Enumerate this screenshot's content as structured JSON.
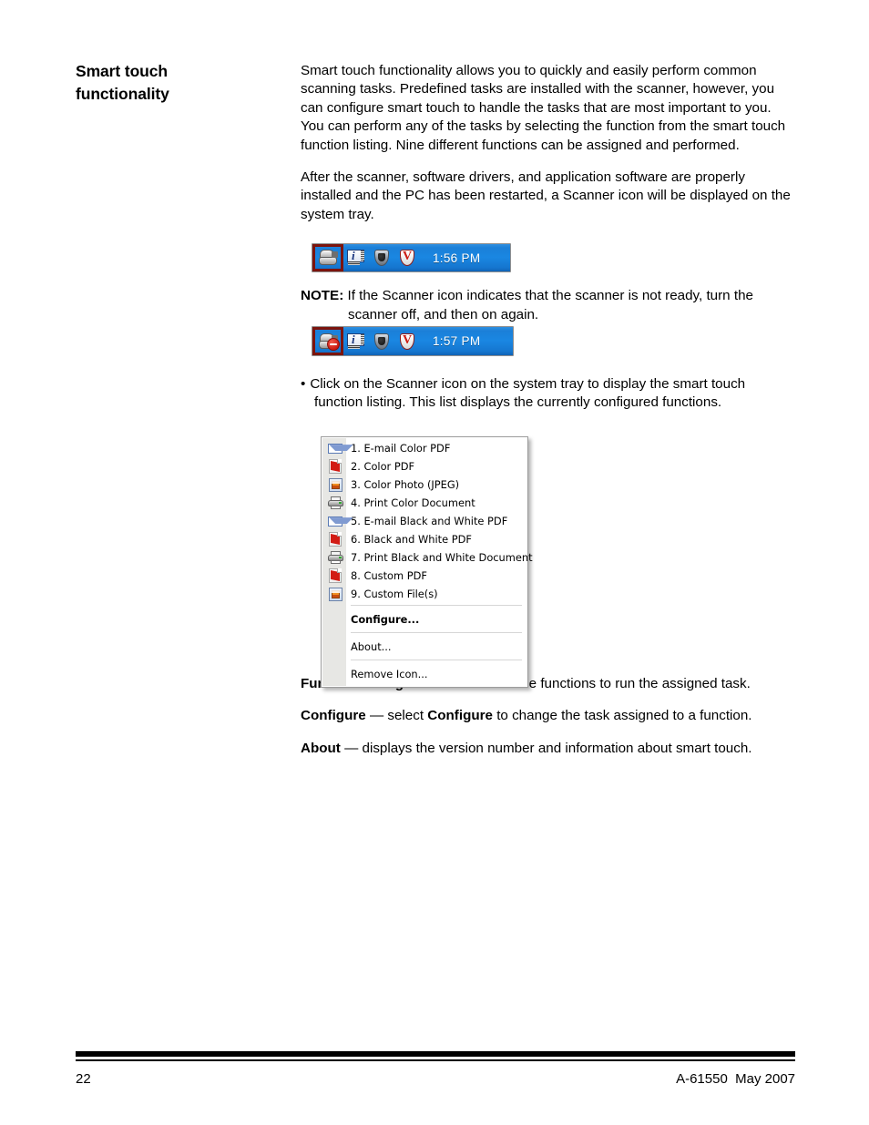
{
  "heading": {
    "line1": "Smart touch",
    "line2": "functionality"
  },
  "body": {
    "paragraph1": "Smart touch functionality allows you to quickly and easily perform common scanning tasks. Predefined tasks are installed with the scanner, however, you can configure smart touch to handle the tasks that are most important to you. You can perform any of the tasks by selecting the function from the smart touch function listing. Nine different functions can be assigned and performed.",
    "paragraph2": "After the scanner, software drivers, and application software are properly installed and the PC has been restarted, a Scanner icon will be displayed on the system tray.",
    "note_label": "NOTE:",
    "note_text": "If the Scanner icon indicates that the scanner is not ready, turn the scanner off, and then on again.",
    "bullet_dot": "•",
    "bullet_text": "Click on the Scanner icon on the system tray to display the smart touch function listing. This list displays the currently configured functions."
  },
  "tray_ready": {
    "clock": "1:56 PM",
    "icons": [
      "scanner-icon",
      "info-icon",
      "shield-icon",
      "v-shield-icon"
    ],
    "highlight_color": "#7b140d",
    "background_color": "#1a87e2"
  },
  "tray_not_ready": {
    "clock": "1:57 PM",
    "icons": [
      "scanner-not-ready-icon",
      "info-icon",
      "shield-icon",
      "v-shield-icon"
    ],
    "highlight_color": "#7b140d",
    "background_color": "#1a87e2"
  },
  "context_menu": {
    "functions": [
      {
        "label": "1. E-mail Color PDF",
        "icon": "mail-icon"
      },
      {
        "label": "2. Color PDF",
        "icon": "pdf-icon"
      },
      {
        "label": "3. Color Photo (JPEG)",
        "icon": "photo-icon"
      },
      {
        "label": "4. Print Color Document",
        "icon": "printer-icon"
      },
      {
        "label": "5. E-mail Black and White PDF",
        "icon": "mail-icon"
      },
      {
        "label": "6. Black and White PDF",
        "icon": "pdf-icon"
      },
      {
        "label": "7. Print Black and White Document",
        "icon": "printer-icon"
      },
      {
        "label": "8. Custom PDF",
        "icon": "pdf-icon"
      },
      {
        "label": "9. Custom File(s)",
        "icon": "photo-icon"
      }
    ],
    "commands": [
      {
        "label": "Configure...",
        "bold": true
      },
      {
        "label": "About...",
        "bold": false
      },
      {
        "label": "Remove Icon...",
        "bold": false
      }
    ]
  },
  "definitions": [
    {
      "term": "Function listing",
      "dash": " — ",
      "rest_before": "click on one of the functions to run the assigned task.",
      "emphasis": "",
      "rest_after": ""
    },
    {
      "term": "Configure",
      "dash": " — ",
      "rest_before": "select ",
      "emphasis": "Configure",
      "rest_after": " to change the task assigned to a function."
    },
    {
      "term": "About",
      "dash": " — ",
      "rest_before": "displays the version number and information about smart touch.",
      "emphasis": "",
      "rest_after": ""
    }
  ],
  "footer": {
    "page_number": "22",
    "doc_id": "A-61550  May 2007"
  }
}
